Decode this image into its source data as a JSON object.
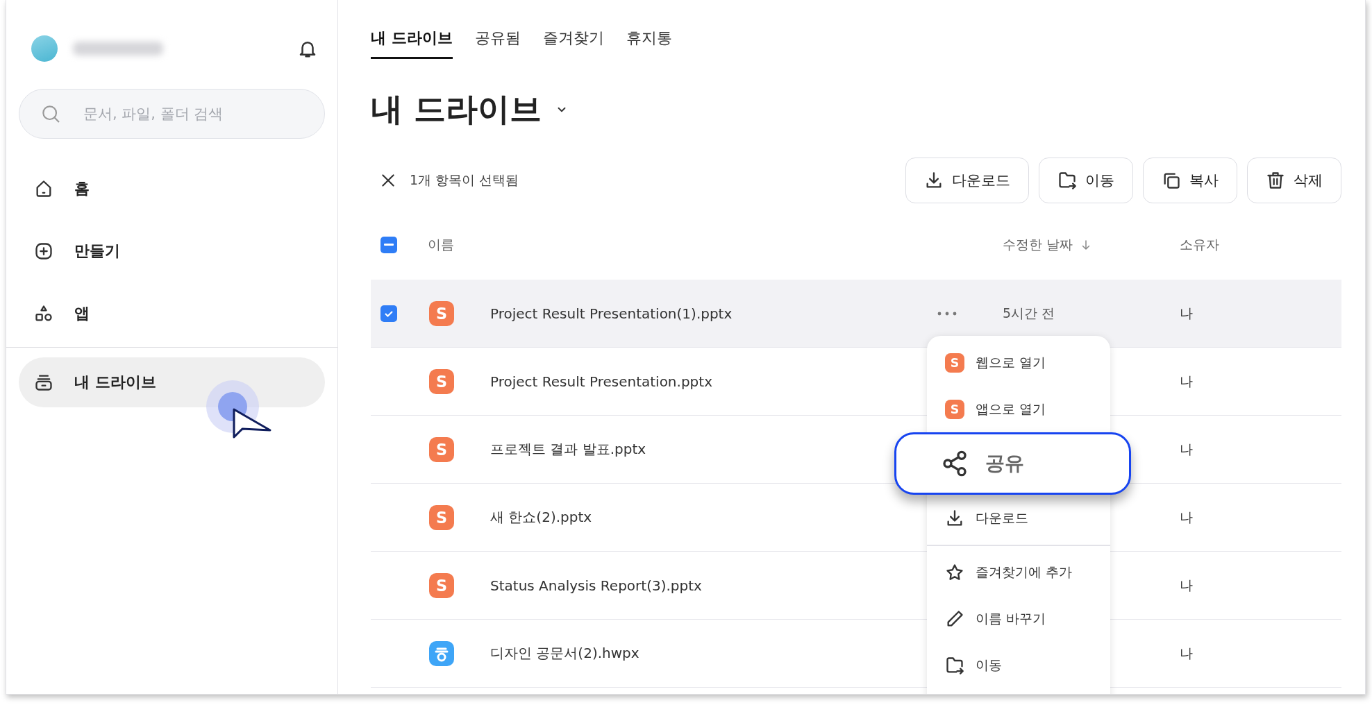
{
  "sidebar": {
    "search": {
      "placeholder": "문서, 파일, 폴더 검색"
    },
    "nav_items": [
      {
        "label": "홈",
        "kind": "home",
        "selected": false
      },
      {
        "label": "만들기",
        "kind": "create",
        "selected": false
      },
      {
        "label": "앱",
        "kind": "apps",
        "selected": false
      }
    ],
    "drive_items": [
      {
        "label": "내 드라이브",
        "kind": "drive",
        "selected": true
      }
    ]
  },
  "tabs": [
    {
      "label": "내 드라이브",
      "selected": true
    },
    {
      "label": "공유됨",
      "selected": false
    },
    {
      "label": "즐겨찾기",
      "selected": false
    },
    {
      "label": "휴지통",
      "selected": false
    }
  ],
  "title": "내 드라이브",
  "selection_bar": {
    "text": "1개 항목이 선택됨",
    "actions": [
      {
        "label": "다운로드",
        "kind": "download"
      },
      {
        "label": "이동",
        "kind": "move"
      },
      {
        "label": "복사",
        "kind": "copy"
      },
      {
        "label": "삭제",
        "kind": "trash"
      }
    ]
  },
  "table": {
    "header_checkbox": {
      "partial": true
    },
    "columns": [
      {
        "label": "이름"
      },
      {
        "label": "수정한 날짜",
        "sorted": true
      },
      {
        "label": "소유자"
      }
    ],
    "rows": [
      {
        "name": "Project Result Presentation(1).pptx",
        "kind": "slides",
        "badge": "S",
        "modified": "5시간 전",
        "owner": "나",
        "selected": true,
        "more_button": true
      },
      {
        "name": "Project Result Presentation.pptx",
        "kind": "slides",
        "badge": "S",
        "owner": "나",
        "selected": false
      },
      {
        "name": "프로젝트 결과 발표.pptx",
        "kind": "slides",
        "badge": "S",
        "owner": "나",
        "selected": false
      },
      {
        "name": "새 한쇼(2).pptx",
        "kind": "slides",
        "badge": "S",
        "owner": "나",
        "selected": false
      },
      {
        "name": "Status Analysis Report(3).pptx",
        "kind": "slides",
        "badge": "S",
        "owner": "나",
        "selected": false
      },
      {
        "name": "디자인 공문서(2).hwpx",
        "kind": "hangul",
        "owner": "나",
        "selected": false
      }
    ]
  },
  "context_menu": {
    "items": [
      {
        "label": "웹으로 열기",
        "kind": "badge",
        "badge": "S",
        "highlighted": false
      },
      {
        "label": "앱으로 열기",
        "kind": "badge",
        "badge": "S",
        "highlighted": false
      },
      {
        "label": "공유",
        "kind": "share",
        "highlighted": true
      },
      {
        "label": "다운로드",
        "kind": "download",
        "highlighted": false,
        "divider_after": true
      },
      {
        "label": "즐겨찾기에 추가",
        "kind": "star",
        "highlighted": false
      },
      {
        "label": "이름 바꾸기",
        "kind": "pencil",
        "highlighted": false
      },
      {
        "label": "이동",
        "kind": "move",
        "highlighted": false
      }
    ]
  }
}
